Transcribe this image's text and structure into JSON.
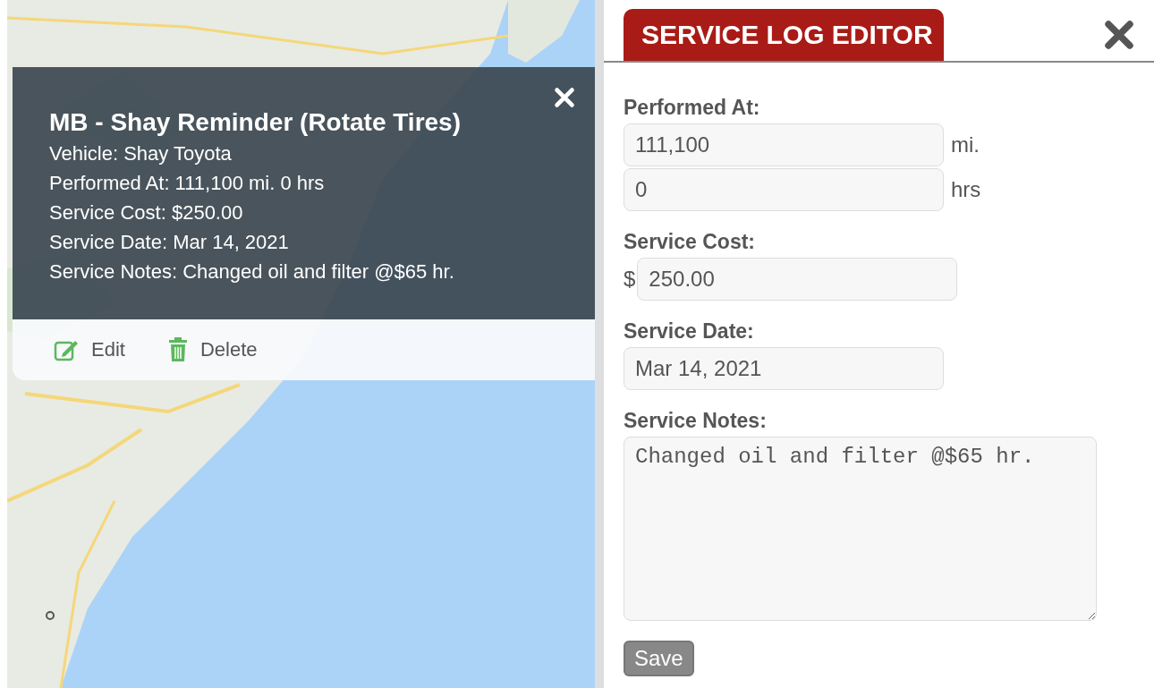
{
  "popup": {
    "title": "MB - Shay Reminder (Rotate Tires)",
    "lines": [
      "Vehicle: Shay Toyota",
      "Performed At: 111,100 mi. 0 hrs",
      "Service Cost: $250.00",
      "Service Date: Mar 14, 2021",
      "Service Notes: Changed oil and filter @$65 hr."
    ],
    "actions": [
      {
        "kind": "edit",
        "label": "Edit"
      },
      {
        "kind": "delete",
        "label": "Delete"
      }
    ]
  },
  "editor": {
    "tab": {
      "label": "SERVICE LOG EDITOR",
      "selected": true
    },
    "performed_at": {
      "label": "Performed At:",
      "miles": "111,100",
      "miles_unit": "mi.",
      "hours": "0",
      "hours_unit": "hrs"
    },
    "service_cost": {
      "label": "Service Cost:",
      "prefix": "$",
      "value": "250.00"
    },
    "service_date": {
      "label": "Service Date:",
      "value": "Mar 14, 2021"
    },
    "service_notes": {
      "label": "Service Notes:",
      "value": "Changed oil and filter @$65 hr."
    },
    "save_button": "Save"
  }
}
